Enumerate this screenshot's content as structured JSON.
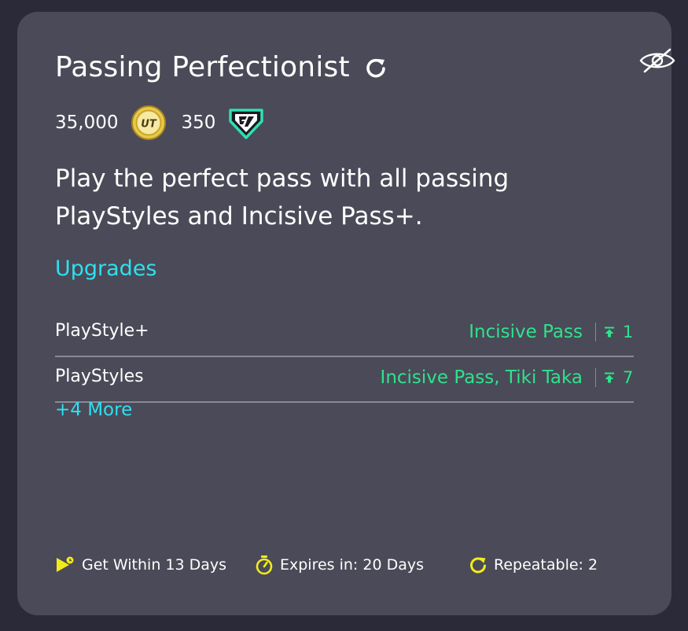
{
  "objective": {
    "title": "Passing Perfectionist",
    "rewards": {
      "coins": "35,000",
      "season_points": "350"
    },
    "description": "Play the perfect pass with all passing PlayStyles and Incisive Pass+.",
    "upgrades": {
      "heading": "Upgrades",
      "rows": [
        {
          "label": "PlayStyle+",
          "value": "Incisive Pass",
          "count": "1"
        },
        {
          "label": "PlayStyles",
          "value": "Incisive Pass, Tiki Taka",
          "count": "7"
        }
      ],
      "more_label": "+4 More"
    },
    "footer": {
      "get_within": "Get Within 13 Days",
      "expires": "Expires in: 20 Days",
      "repeatable": "Repeatable: 2"
    }
  },
  "colors": {
    "card_background": "#4b4a58",
    "page_background": "#2a2a38",
    "accent_cyan": "#2ee0f0",
    "accent_green": "#2ee38c",
    "footer_icon_yellow": "#f2ec1a",
    "coin_gold": "#e8c94a"
  },
  "icons": {
    "hide": "eye-slash-icon",
    "title_repeat": "refresh-icon",
    "coin": "ut-coin-icon",
    "season_points": "fc-shield-icon",
    "level": "level-up-icon",
    "get_within": "flag-clock-icon",
    "expires": "stopwatch-icon",
    "repeatable": "repeat-icon"
  }
}
